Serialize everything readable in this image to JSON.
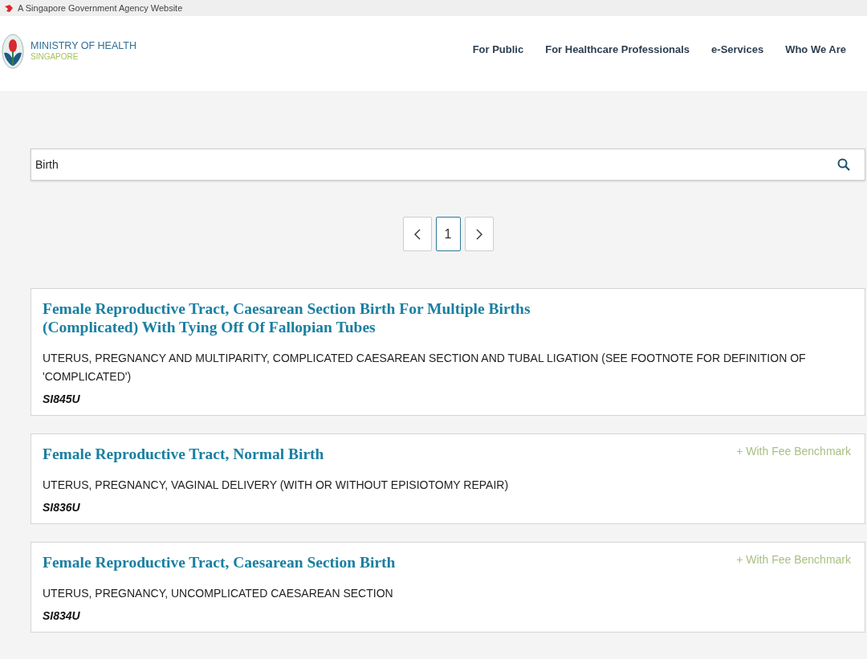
{
  "gov_bar": {
    "text": "A Singapore Government Agency Website"
  },
  "logo": {
    "name": "MINISTRY OF HEALTH",
    "sub": "SINGAPORE"
  },
  "nav": [
    {
      "label": "For Public"
    },
    {
      "label": "For Healthcare Professionals"
    },
    {
      "label": "e-Services"
    },
    {
      "label": "Who We Are"
    }
  ],
  "search": {
    "value": "Birth"
  },
  "pagination": {
    "pages": [
      {
        "label": "1",
        "selected": true
      }
    ]
  },
  "results": [
    {
      "title": "Female Reproductive Tract, Caesarean Section Birth For Multiple Births (Complicated) With Tying Off Of Fallopian Tubes",
      "description": "UTERUS, PREGNANCY AND MULTIPARITY, COMPLICATED CAESAREAN SECTION AND TUBAL LIGATION (SEE FOOTNOTE FOR DEFINITION OF 'COMPLICATED')",
      "code": "SI845U"
    },
    {
      "title": "Female Reproductive Tract, Normal Birth",
      "badge": "+ With Fee Benchmark",
      "description": "UTERUS, PREGNANCY, VAGINAL DELIVERY (WITH OR WITHOUT EPISIOTOMY REPAIR)",
      "code": "SI836U"
    },
    {
      "title": "Female Reproductive Tract, Caesarean Section Birth",
      "badge": "+ With Fee Benchmark",
      "description": "UTERUS, PREGNANCY, UNCOMPLICATED CAESAREAN SECTION",
      "code": "SI834U"
    }
  ]
}
